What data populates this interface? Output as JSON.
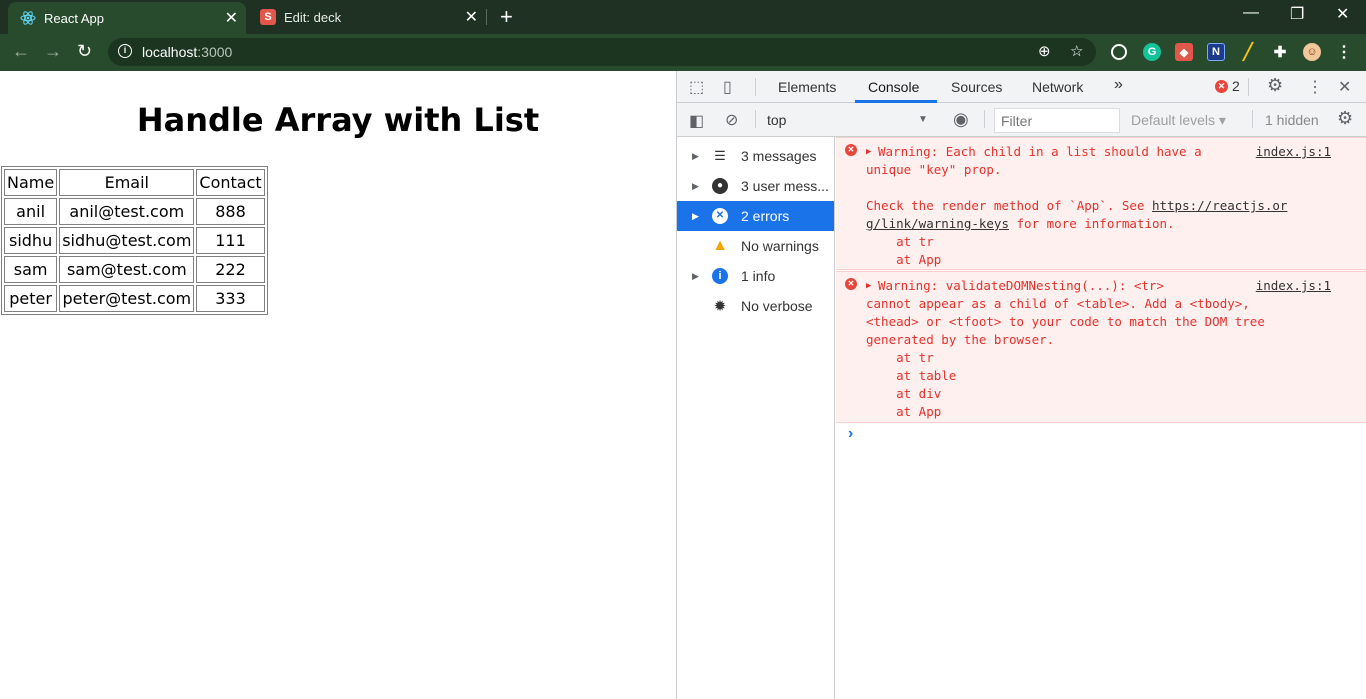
{
  "browser": {
    "tabs": [
      {
        "title": "React App",
        "active": true
      },
      {
        "title": "Edit: deck",
        "active": false
      }
    ],
    "url_host": "localhost",
    "url_port": ":3000"
  },
  "page": {
    "heading": "Handle Array with List",
    "table": {
      "header": [
        "Name",
        "Email",
        "Contact"
      ],
      "rows": [
        [
          "anil",
          "anil@test.com",
          "888"
        ],
        [
          "sidhu",
          "sidhu@test.com",
          "111"
        ],
        [
          "sam",
          "sam@test.com",
          "222"
        ],
        [
          "peter",
          "peter@test.com",
          "333"
        ]
      ]
    }
  },
  "devtools": {
    "tabs": [
      "Elements",
      "Console",
      "Sources",
      "Network"
    ],
    "active_tab": "Console",
    "more_tabs": "»",
    "error_count": "2",
    "context": "top",
    "filter_placeholder": "Filter",
    "levels_label": "Default levels",
    "hidden_label": "1 hidden",
    "sidebar": [
      {
        "label": "3 messages",
        "icon": "list-icon",
        "expandable": true,
        "selected": false
      },
      {
        "label": "3 user mess...",
        "icon": "user-icon",
        "expandable": true,
        "selected": false
      },
      {
        "label": "2 errors",
        "icon": "error-icon",
        "expandable": true,
        "selected": true
      },
      {
        "label": "No warnings",
        "icon": "warning-icon",
        "expandable": false,
        "selected": false
      },
      {
        "label": "1 info",
        "icon": "info-icon",
        "expandable": true,
        "selected": false
      },
      {
        "label": "No verbose",
        "icon": "bug-icon",
        "expandable": false,
        "selected": false
      }
    ],
    "messages": [
      {
        "source": "index.js:1",
        "lines": [
          "Warning: Each child in a list should have a",
          "unique \"key\" prop.",
          "",
          "Check the render method of `App`. See ",
          "g/link/warning-keys",
          "    at tr",
          "    at App"
        ],
        "link": "https://reactjs.or",
        "after_link": " for more information."
      },
      {
        "source": "index.js:1",
        "lines": [
          "Warning: validateDOMNesting(...): <tr>",
          "cannot appear as a child of <table>. Add a <tbody>,",
          "<thead> or <tfoot> to your code to match the DOM tree",
          "generated by the browser.",
          "    at tr",
          "    at table",
          "    at div",
          "    at App"
        ]
      }
    ],
    "colors": {
      "accent": "#1a73e8",
      "error": "#e7312b",
      "error_bg": "#fff0f0"
    }
  }
}
